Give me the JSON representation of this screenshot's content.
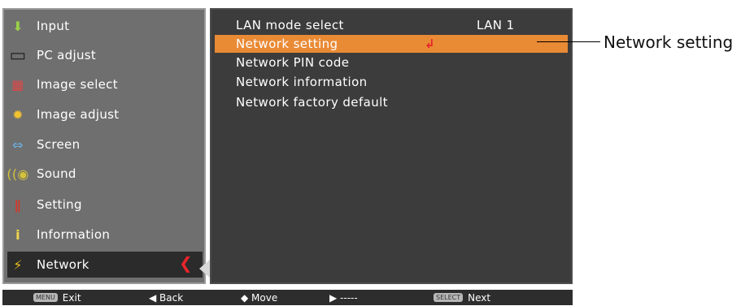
{
  "main_menu": {
    "items": [
      {
        "label": "Input",
        "icon": "input-icon",
        "glyph": "⬇"
      },
      {
        "label": "PC adjust",
        "icon": "pc-adjust-icon",
        "glyph": "▭"
      },
      {
        "label": "Image select",
        "icon": "image-select-icon",
        "glyph": "▦"
      },
      {
        "label": "Image adjust",
        "icon": "image-adjust-icon",
        "glyph": "✹"
      },
      {
        "label": "Screen",
        "icon": "screen-icon",
        "glyph": "⇔"
      },
      {
        "label": "Sound",
        "icon": "sound-icon",
        "glyph": "🔈"
      },
      {
        "label": "Setting",
        "icon": "setting-icon",
        "glyph": "🔧"
      },
      {
        "label": "Information",
        "icon": "information-icon",
        "glyph": "i"
      },
      {
        "label": "Network",
        "icon": "network-icon",
        "glyph": "⚡"
      }
    ],
    "active_index": 8
  },
  "sub_menu": {
    "lan_mode": {
      "label": "LAN mode select",
      "value": "LAN 1"
    },
    "items": [
      {
        "label": "Network setting"
      },
      {
        "label": "Network PIN code"
      },
      {
        "label": "Network information"
      },
      {
        "label": "Network factory default"
      }
    ],
    "highlight_index": 0
  },
  "footer": {
    "menu_key": "MENU",
    "exit": "Exit",
    "back": "◀ Back",
    "move": "◆ Move",
    "forward": "▶ -----",
    "select_key": "SELECT",
    "next": "Next"
  },
  "callout": {
    "label": "Network setting"
  },
  "colors": {
    "highlight": "#e98a35",
    "accent_red": "#e8252b",
    "left_panel": "#6f6f6f",
    "right_panel": "#3c3c3c"
  }
}
